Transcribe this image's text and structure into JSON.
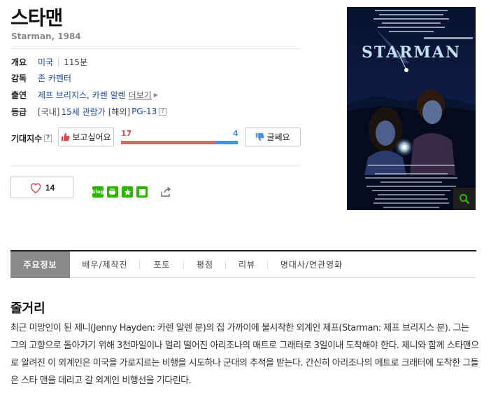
{
  "movie": {
    "title": "스타맨",
    "subtitle": "Starman, 1984"
  },
  "info": {
    "overview_key": "개요",
    "country": "미국",
    "runtime": "115분",
    "director_key": "감독",
    "director": "존 카펜터",
    "cast_key": "출연",
    "cast": "제프 브리지스, 카렌 알렌",
    "more_label": "더보기",
    "rating_key": "등급",
    "domestic_prefix": "[국내]",
    "domestic_rating": "15세 관람가",
    "overseas_prefix": "[해외]",
    "overseas_rating": "PG-13",
    "help_icon": "question-icon"
  },
  "expectation": {
    "label": "기대지수",
    "want_label": "보고싶어요",
    "meh_label": "글쎄요",
    "want_count": "17",
    "meh_count": "4",
    "want_ratio": 0.81,
    "colors": {
      "want": "#e85f63",
      "meh": "#4a90e2"
    }
  },
  "social": {
    "like_count": "14",
    "blog_label": "blog",
    "icons": [
      "blog-icon",
      "cafe-icon",
      "bookmark-star-icon",
      "memo-icon",
      "share-icon"
    ]
  },
  "poster": {
    "title_text": "STARMAN",
    "zoom_icon": "search-icon"
  },
  "tabs": [
    {
      "label": "주요정보"
    },
    {
      "label": "배우/제작진"
    },
    {
      "label": "포토"
    },
    {
      "label": "평점"
    },
    {
      "label": "리뷰"
    },
    {
      "label": "명대사/연관영화"
    }
  ],
  "synopsis": {
    "heading": "줄거리",
    "body": "최근 미망인이 된 제니(Jenny Hayden: 카렌 알렌 분)의 집 가까이에 불시착한 외계인 제프(Starman: 제프 브리지스 분). 그는 그의 고향으로 돌아가기 위해 3천마일이나 멀리 떨어진 아리조나의 매트로 그래터로 3일이내 도착해야 한다. 제니와 함께 스타맨으로 알려진 이 외계인은 미국을 가로지르는 비행을 시도하나 군대의 추적을 받는다. 간신히 아리조나의 메트로 크래터에 도착한 그들은 스타 맨을 데리고 갈 외계인 비행선을 기다린다."
  }
}
